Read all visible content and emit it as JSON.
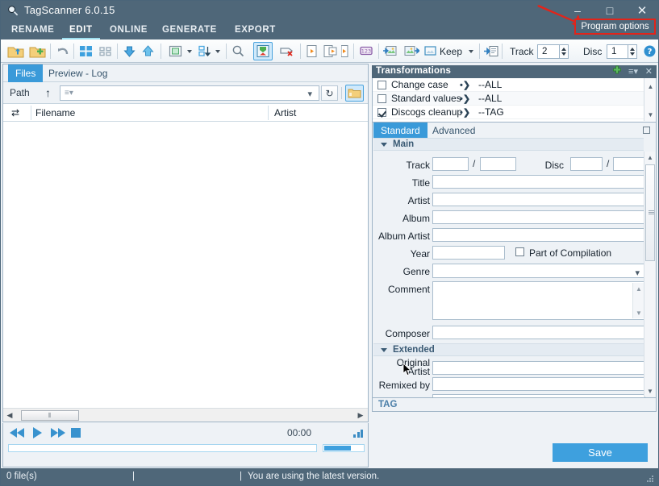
{
  "window": {
    "title": "TagScanner 6.0.15",
    "logo_icon": "magnifier-icon",
    "minimize_label": "–",
    "maximize_label": "□",
    "close_label": "✕"
  },
  "callout": {
    "label": "Program options",
    "border_color": "#e2241a",
    "arrow_color": "#e2241a",
    "arrow_icon": "red-arrow-annotation"
  },
  "menu": {
    "items": [
      {
        "label": "RENAME",
        "active": false
      },
      {
        "label": "EDIT",
        "active": true
      },
      {
        "label": "ONLINE",
        "active": false
      },
      {
        "label": "GENERATE",
        "active": false
      },
      {
        "label": "EXPORT",
        "active": false
      }
    ]
  },
  "toolbar": {
    "icons": [
      "open-folder-icon",
      "add-folder-icon",
      "undo-icon",
      "large-icons-view-icon",
      "small-icons-view-icon",
      "move-down-icon",
      "move-up-icon",
      "select-all-icon",
      "sort-icon",
      "search-icon",
      "tag-import-icon",
      "clear-tag-icon",
      "playlist-icon",
      "playlist-add-icon",
      "playlist-play-icon",
      "numbering-icon",
      "image-import-icon",
      "image-export-icon",
      "artwork-keep-icon",
      "tag-to-file-icon",
      "help-icon"
    ],
    "keep_label": "Keep",
    "track_label": "Track",
    "track_value": "2",
    "disc_label": "Disc",
    "disc_value": "1"
  },
  "files_pane": {
    "tabs": [
      {
        "label": "Files",
        "active": true
      },
      {
        "label": "Preview - Log",
        "active": false
      }
    ],
    "path": {
      "label": "Path",
      "up_icon": "arrow-up-icon",
      "value": "",
      "placeholder": "",
      "dropdown_icon": "chevron-down-icon",
      "refresh_icon": "refresh-icon",
      "browse_icon": "browse-folder-icon"
    },
    "grid": {
      "shuffle_icon": "shuffle-icon",
      "columns": [
        "Filename",
        "Artist"
      ],
      "rows": []
    },
    "hscroll": {
      "left_icon": "chevron-left-icon",
      "right_icon": "chevron-right-icon",
      "thumb_grip": "⫴"
    }
  },
  "player": {
    "prev_icon": "rewind-icon",
    "play_icon": "play-icon",
    "next_icon": "fast-forward-icon",
    "stop_icon": "stop-icon",
    "time": "00:00",
    "progress_percent": 0,
    "volume_percent": 62,
    "equalizer_icon": "equalizer-icon"
  },
  "transformations": {
    "title": "Transformations",
    "add_icon": "plus-icon",
    "menu_icon": "list-menu-icon",
    "close_icon": "close-icon",
    "rows": [
      {
        "label": "Change case",
        "checked": false,
        "arrow_icon": "apply-arrow-icon",
        "scope": "--ALL"
      },
      {
        "label": "Standard values",
        "checked": false,
        "arrow_icon": "apply-arrow-icon",
        "scope": "--ALL"
      },
      {
        "label": "Discogs cleanup",
        "checked": true,
        "arrow_icon": "apply-arrow-icon",
        "scope": "--TAG"
      }
    ],
    "scroll_up_icon": "caret-up-icon",
    "scroll_down_icon": "caret-down-icon"
  },
  "editor": {
    "tabs": [
      {
        "label": "Standard",
        "active": true
      },
      {
        "label": "Advanced",
        "active": false
      }
    ],
    "restore_icon": "restore-window-icon",
    "sections": [
      {
        "label": "Main"
      },
      {
        "label": "Extended"
      }
    ],
    "fields": {
      "track_label": "Track",
      "track_value": "",
      "track_total_value": "",
      "disc_label": "Disc",
      "disc_value": "",
      "disc_total_value": "",
      "separator": "/",
      "title_label": "Title",
      "title_value": "",
      "artist_label": "Artist",
      "artist_value": "",
      "album_label": "Album",
      "album_value": "",
      "album_artist_label": "Album Artist",
      "album_artist_value": "",
      "year_label": "Year",
      "year_value": "",
      "compilation_label": "Part of Compilation",
      "compilation_checked": false,
      "genre_label": "Genre",
      "genre_value": "",
      "genre_caret_icon": "chevron-down-icon",
      "comment_label": "Comment",
      "comment_value": "",
      "composer_label": "Composer",
      "composer_value": "",
      "original_artist_label": "Original Artist",
      "original_artist_value": "",
      "remixed_by_label": "Remixed by",
      "remixed_by_value": ""
    },
    "tag_bar_label": "TAG",
    "save_label": "Save",
    "save_color": "#3ea0de"
  },
  "statusbar": {
    "file_count": "0 file(s)",
    "separator1": "|",
    "separator2": "|",
    "version_message": "You are using the latest version.",
    "resize_grip_icon": "resize-grip-icon"
  }
}
